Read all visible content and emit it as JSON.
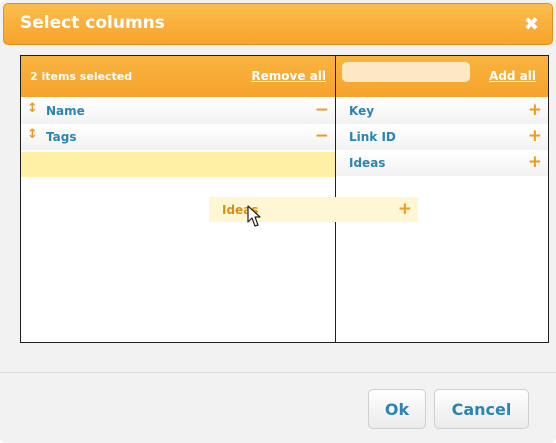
{
  "dialog": {
    "title": "Select columns",
    "close_glyph": "✖"
  },
  "selected_pane": {
    "count_label": "2 items selected",
    "remove_all_label": "Remove all",
    "items": [
      {
        "label": "Name",
        "handle_glyph": "↕",
        "action_glyph": "−"
      },
      {
        "label": "Tags",
        "handle_glyph": "↕",
        "action_glyph": "−"
      }
    ]
  },
  "available_pane": {
    "search_value": "",
    "search_placeholder": "",
    "add_all_label": "Add all",
    "items": [
      {
        "label": "Key",
        "action_glyph": "+"
      },
      {
        "label": "Link ID",
        "action_glyph": "+"
      },
      {
        "label": "Ideas",
        "action_glyph": "+"
      }
    ]
  },
  "drag": {
    "dragged_item_label": "Ideas",
    "action_glyph": "+",
    "cursor_icon": "hand-grab-icon"
  },
  "footer": {
    "ok_label": "Ok",
    "cancel_label": "Cancel"
  },
  "colors": {
    "accent_orange": "#f7a42a",
    "link_blue": "#2a85b3",
    "drop_placeholder": "#fff0a6"
  }
}
